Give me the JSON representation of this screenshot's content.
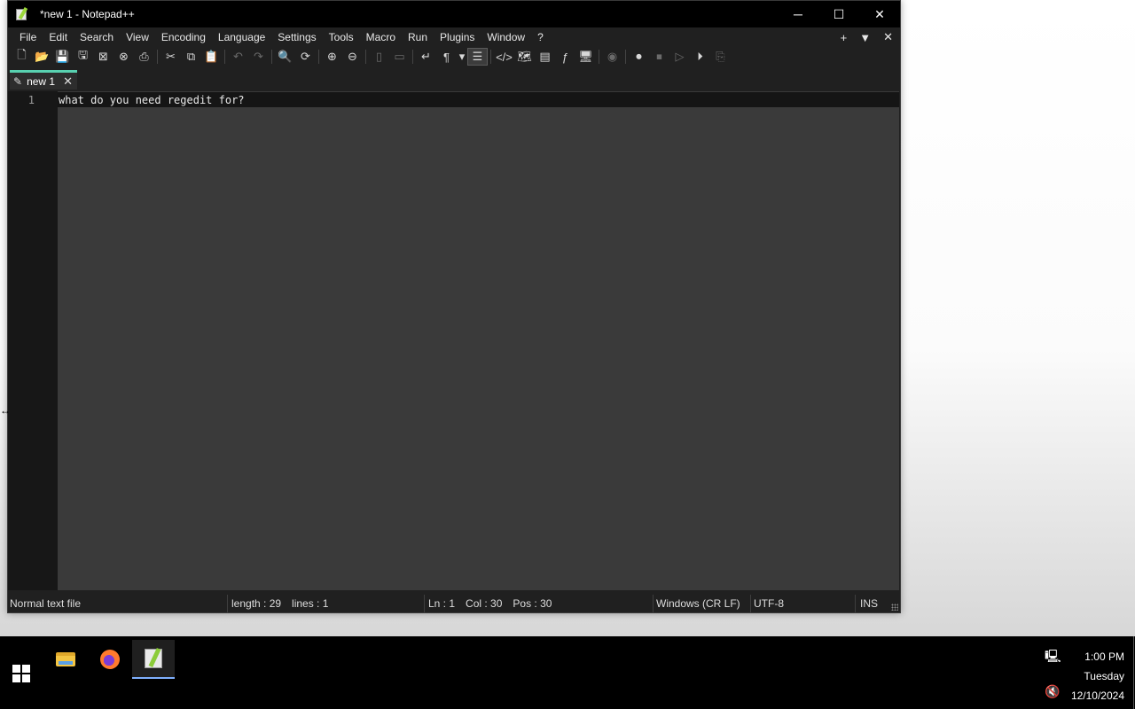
{
  "window": {
    "title": "*new 1 - Notepad++",
    "controls": {
      "minimize": "─",
      "maximize": "☐",
      "close": "✕"
    }
  },
  "menu": {
    "items": [
      "File",
      "Edit",
      "Search",
      "View",
      "Encoding",
      "Language",
      "Settings",
      "Tools",
      "Macro",
      "Run",
      "Plugins",
      "Window",
      "?"
    ],
    "right": {
      "add": "+",
      "dropdown": "▼",
      "close": "✕"
    }
  },
  "tabs": [
    {
      "label": "new 1",
      "close": "✕",
      "active": true
    }
  ],
  "editor": {
    "line_numbers": [
      "1"
    ],
    "lines": [
      "what do you need regedit for?"
    ]
  },
  "status": {
    "file_type": "Normal text file",
    "length": "length : 29",
    "lines": "lines : 1",
    "ln": "Ln : 1",
    "col": "Col : 30",
    "pos": "Pos : 30",
    "eol": "Windows (CR LF)",
    "encoding": "UTF-8",
    "mode": "INS"
  },
  "taskbar": {
    "apps": [
      "file-explorer",
      "firefox",
      "notepad-plus-plus"
    ],
    "clock": {
      "time": "1:00 PM",
      "day": "Tuesday",
      "date": "12/10/2024"
    }
  },
  "colors": {
    "tab_accent": "#58d1b0",
    "editor_bg": "#3a3a3a",
    "gutter_bg": "#171717",
    "chrome_bg": "#202020"
  }
}
